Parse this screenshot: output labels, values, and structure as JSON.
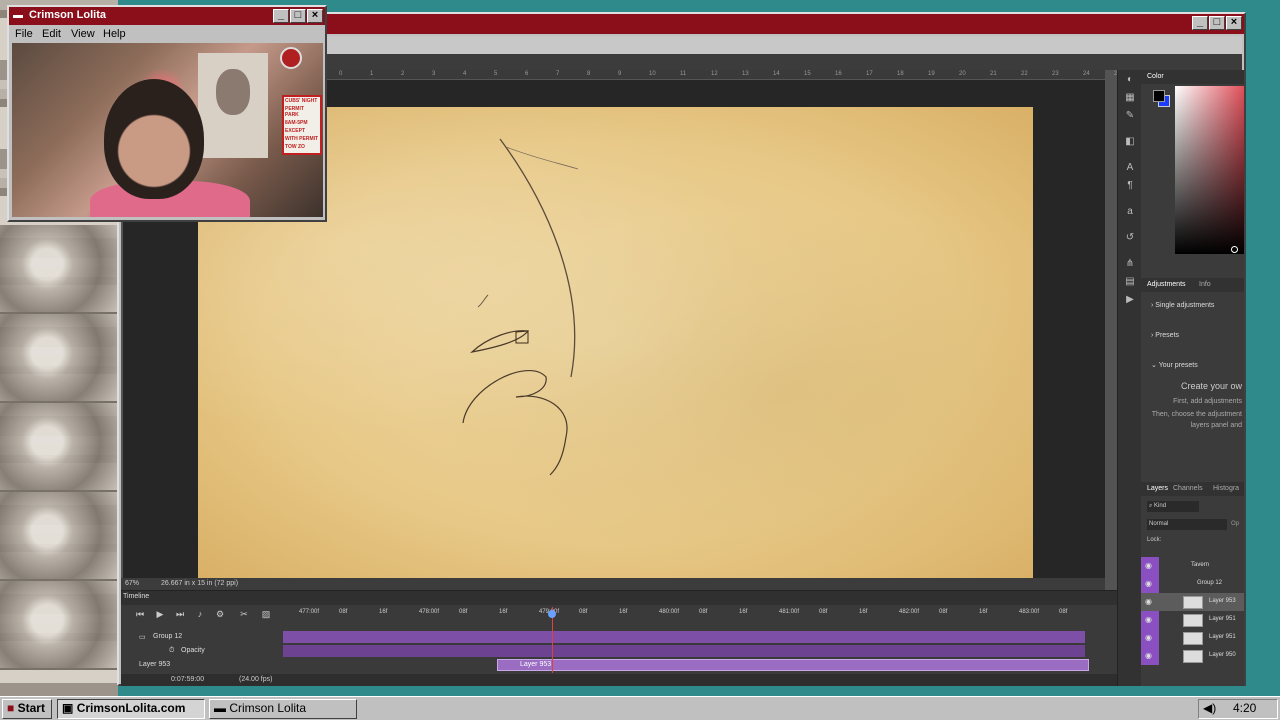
{
  "webcam_window": {
    "title": "Crimson Lolita",
    "menu": [
      "File",
      "Edit",
      "View",
      "Help"
    ],
    "sign_lines": [
      "CUBS' NIGHT",
      "PERMIT PARK",
      "8AM-5PM",
      "EXCEPT",
      "WITH PERMIT",
      "TOW ZO"
    ]
  },
  "ps": {
    "status_zoom": "67%",
    "status_doc": "26.667 in x 15 in (72 ppi)",
    "ruler_labels": [
      "1",
      "6",
      "4",
      "3",
      "2",
      "1",
      "0",
      "1",
      "2",
      "3",
      "4",
      "5",
      "6",
      "7",
      "8",
      "9",
      "10",
      "11",
      "12",
      "13",
      "14",
      "15",
      "16",
      "17",
      "18",
      "19",
      "20",
      "21",
      "22",
      "23",
      "24",
      "25",
      "26",
      "27",
      "28"
    ],
    "timeline": {
      "tab": "Timeline",
      "time_labels": [
        "477:00f",
        "08f",
        "16f",
        "478:00f",
        "08f",
        "16f",
        "479:00f",
        "08f",
        "16f",
        "480:00f",
        "08f",
        "16f",
        "481:00f",
        "08f",
        "16f",
        "482:00f",
        "08f",
        "16f",
        "483:00f",
        "08f"
      ],
      "rows": {
        "group": "Group 12",
        "opacity": "Opacity",
        "layer": "Layer 953"
      },
      "clip_label": "Layer 953",
      "current_time": "0:07:59:00",
      "fps": "(24.00 fps)"
    },
    "color_panel": {
      "tab": "Color",
      "fg": "#000000",
      "bg": "#1a3cff"
    },
    "adjustments": {
      "tabs": [
        "Adjustments",
        "Info"
      ],
      "items": [
        "Single adjustments",
        "Presets",
        "Your presets"
      ],
      "create_title": "Create your ow",
      "create_lines": [
        "First, add adjustments",
        "Then, choose the adjustment",
        "layers panel and"
      ]
    },
    "layers": {
      "tabs": [
        "Layers",
        "Channels",
        "Histogra"
      ],
      "kind": "Kind",
      "blend": "Normal",
      "opacity_short": "Op",
      "lock_label": "Lock:",
      "rows": [
        {
          "name": "Tavern",
          "type": "group"
        },
        {
          "name": "Group 12",
          "type": "group"
        },
        {
          "name": "Layer 953",
          "type": "layer",
          "selected": true
        },
        {
          "name": "Layer 951",
          "type": "layer"
        },
        {
          "name": "Layer 951",
          "type": "layer"
        },
        {
          "name": "Layer 950",
          "type": "layer"
        }
      ]
    }
  },
  "taskbar": {
    "start": "Start",
    "buttons": [
      "CrimsonLolita.com",
      "Crimson Lolita"
    ],
    "clock": "4:20 PM"
  },
  "colors": {
    "titlebar": "#8a0f1a",
    "timeline_track": "#7e4fa6",
    "canvas": "#e7c886"
  }
}
